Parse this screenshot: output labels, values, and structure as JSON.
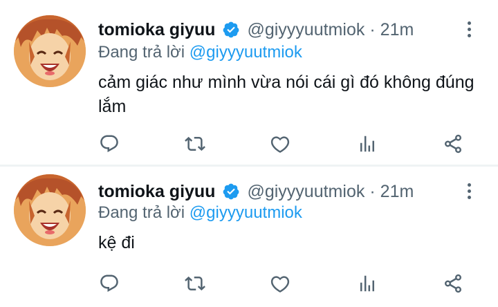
{
  "colors": {
    "accent": "#1d9bf0",
    "secondary_text": "#536471",
    "primary_text": "#0f1419",
    "divider": "#eff3f4"
  },
  "tweets": [
    {
      "display_name": "tomioka giyuu",
      "handle": "@giyyyuutmiok",
      "separator": "·",
      "time": "21m",
      "reply_prefix": "Đang trả lời",
      "reply_to": "@giyyyuutmiok",
      "text": "cảm giác như mình vừa nói cái gì đó không đúng lắm",
      "icons": [
        "reply-icon",
        "retweet-icon",
        "like-icon",
        "views-icon",
        "share-icon",
        "more-icon",
        "verified-badge-icon"
      ]
    },
    {
      "display_name": "tomioka giyuu",
      "handle": "@giyyyuutmiok",
      "separator": "·",
      "time": "21m",
      "reply_prefix": "Đang trả lời",
      "reply_to": "@giyyyuutmiok",
      "text": "kệ đi",
      "icons": [
        "reply-icon",
        "retweet-icon",
        "like-icon",
        "views-icon",
        "share-icon",
        "more-icon",
        "verified-badge-icon"
      ]
    }
  ]
}
